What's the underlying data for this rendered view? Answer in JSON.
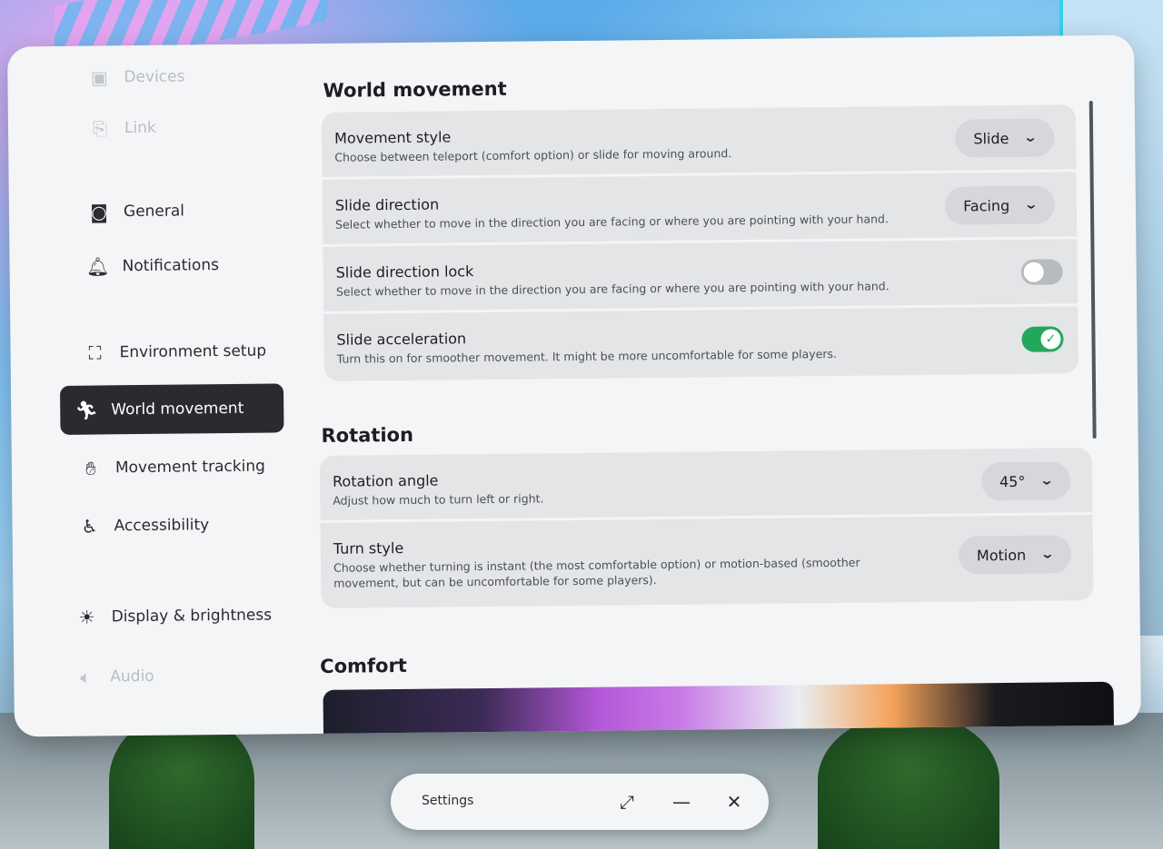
{
  "sidebar": {
    "items": [
      {
        "label": "Devices",
        "icon": "device-icon",
        "state": "faded"
      },
      {
        "label": "Link",
        "icon": "link-icon",
        "state": "faded"
      },
      {
        "label": "General",
        "icon": "headset-icon",
        "state": "normal"
      },
      {
        "label": "Notifications",
        "icon": "bell-icon",
        "state": "normal"
      },
      {
        "label": "Environment setup",
        "icon": "boundary-icon",
        "state": "normal"
      },
      {
        "label": "World movement",
        "icon": "running-person-icon",
        "state": "selected"
      },
      {
        "label": "Movement tracking",
        "icon": "tracking-person-icon",
        "state": "normal"
      },
      {
        "label": "Accessibility",
        "icon": "accessibility-icon",
        "state": "normal"
      },
      {
        "label": "Display & brightness",
        "icon": "sun-icon",
        "state": "normal"
      },
      {
        "label": "Audio",
        "icon": "speaker-icon",
        "state": "faded"
      }
    ]
  },
  "world_movement": {
    "title": "World movement",
    "movement_style": {
      "title": "Movement style",
      "desc": "Choose between teleport (comfort option) or slide for moving around.",
      "value": "Slide"
    },
    "slide_direction": {
      "title": "Slide direction",
      "desc": "Select whether to move in the direction you are facing or where you are pointing with your hand.",
      "value": "Facing"
    },
    "slide_direction_lock": {
      "title": "Slide direction lock",
      "desc": "Select whether to move in the direction you are facing or where you are pointing with your hand.",
      "enabled": false
    },
    "slide_acceleration": {
      "title": "Slide acceleration",
      "desc": "Turn this on for smoother movement. It might be more uncomfortable for some players.",
      "enabled": true
    }
  },
  "rotation": {
    "title": "Rotation",
    "rotation_angle": {
      "title": "Rotation angle",
      "desc": "Adjust how much to turn left or right.",
      "value": "45°"
    },
    "turn_style": {
      "title": "Turn style",
      "desc": "Choose whether turning is instant (the most comfortable option) or motion-based (smoother movement, but can be uncomfortable for some players).",
      "value": "Motion"
    }
  },
  "comfort": {
    "title": "Comfort"
  },
  "window": {
    "title": "Settings"
  },
  "colors": {
    "selected_bg": "#2a2b2e",
    "toggle_on": "#23a85b",
    "panel_bg": "#f4f5f6"
  }
}
